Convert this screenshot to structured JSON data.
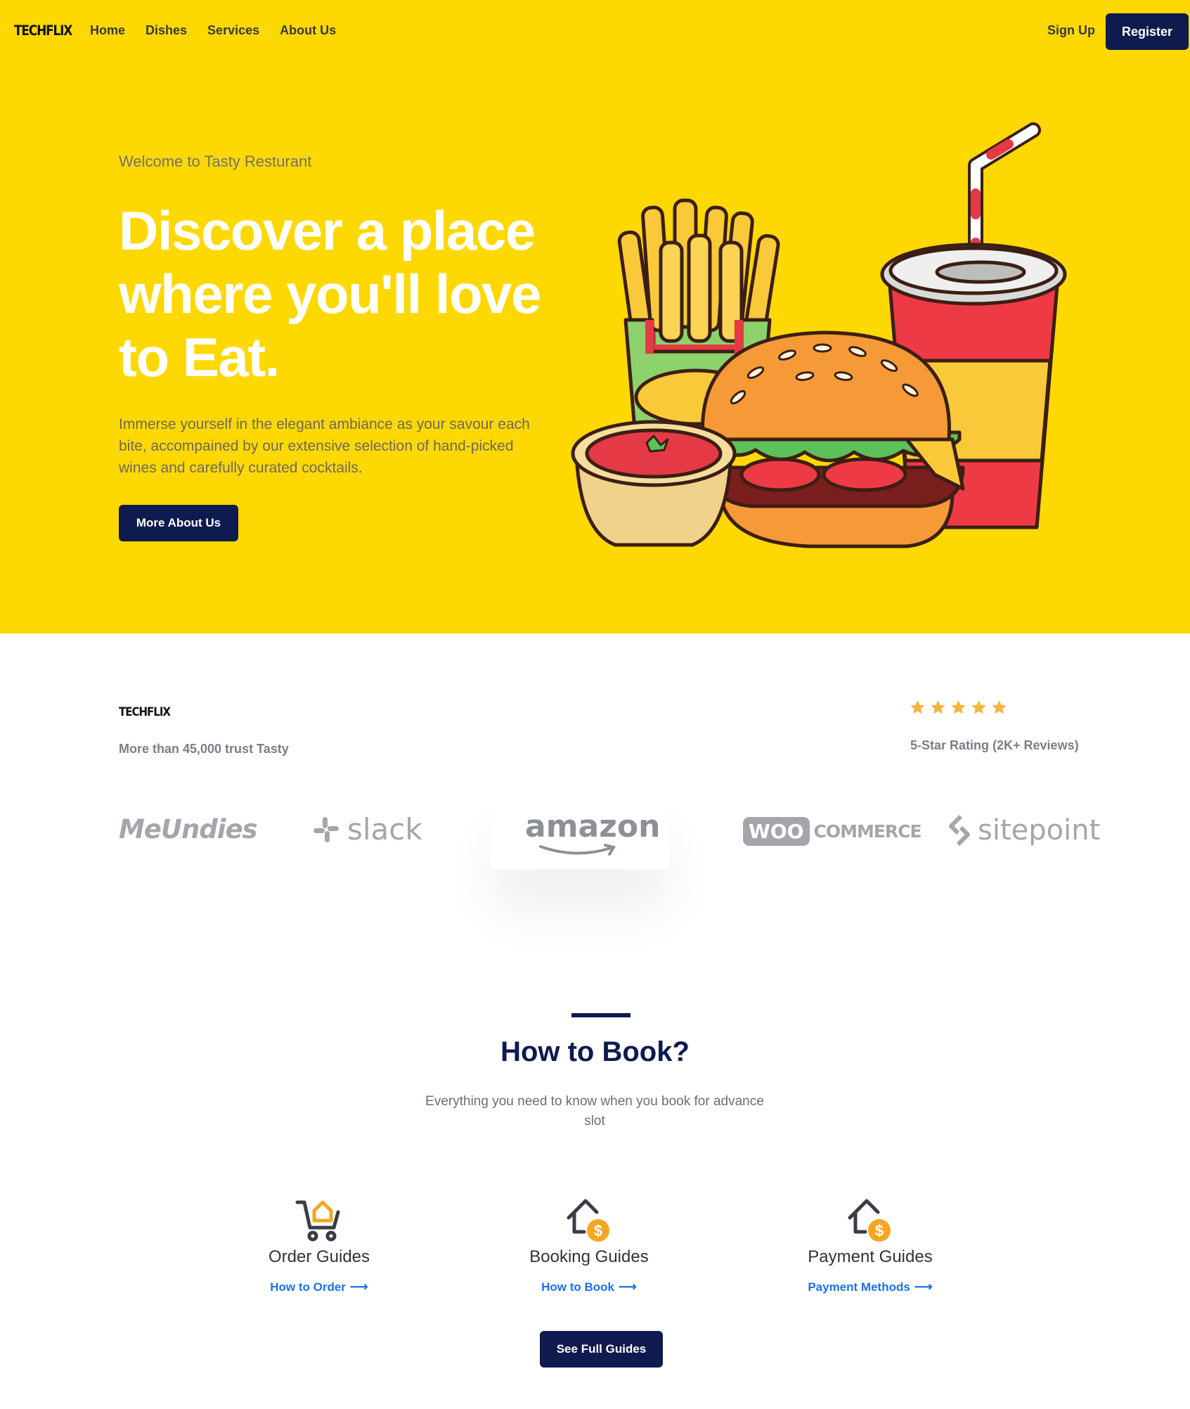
{
  "nav": {
    "logo": "TECHFLIX",
    "links": [
      "Home",
      "Dishes",
      "Services",
      "About Us"
    ],
    "signup": "Sign Up",
    "register": "Register"
  },
  "hero": {
    "eyebrow": "Welcome to Tasty Resturant",
    "title": "Discover a place where you'll love to Eat.",
    "description": "Immerse yourself in the elegant ambiance as your savour each bite, accompained by our extensive selection of hand-picked wines and carefully curated cocktails.",
    "button": "More About Us",
    "background_color": "#FDD802"
  },
  "trust": {
    "logo": "TECHFLIX",
    "text": "More than 45,000 trust Tasty",
    "stars": 5,
    "rating_text": "5-Star Rating (2K+ Reviews)",
    "star_color": "#F5B53F"
  },
  "brands": [
    "MeUndies",
    "slack",
    "amazon",
    "WOO COMMERCE",
    "sitepoint"
  ],
  "how_to_book": {
    "title": "How to Book?",
    "subtitle": "Everything you need to know when you book for advance slot",
    "guides": [
      {
        "icon": "cart-house-icon",
        "title": "Order Guides",
        "link": "How to Order"
      },
      {
        "icon": "house-dollar-icon",
        "title": "Booking Guides",
        "link": "How to Book"
      },
      {
        "icon": "house-dollar-icon",
        "title": "Payment Guides",
        "link": "Payment Methods"
      }
    ],
    "button": "See Full Guides"
  },
  "colors": {
    "primary": "#0F1A4E",
    "link": "#1a73e8",
    "accent_orange": "#F5A623"
  }
}
